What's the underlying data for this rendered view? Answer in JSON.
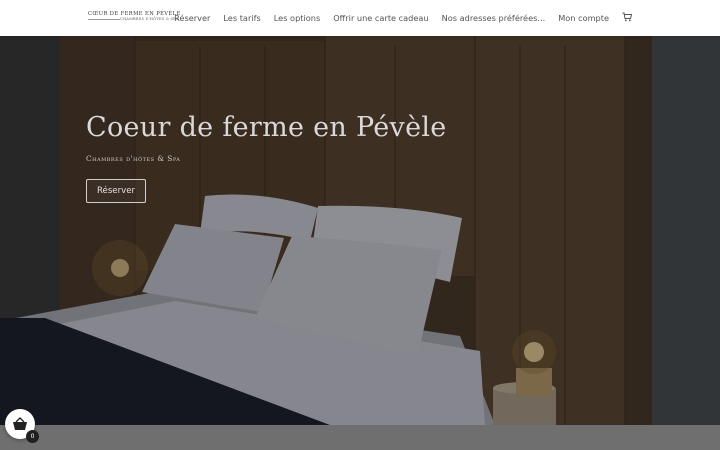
{
  "logo": {
    "title": "Cœur de ferme en Pévèle",
    "subtitle": "Chambres d'hôtes & Spa"
  },
  "nav": {
    "items": [
      "Réserver",
      "Les tarifs",
      "Les options",
      "Offrir une carte cadeau",
      "Nos adresses préférées...",
      "Mon compte"
    ],
    "cart_icon": "cart-icon"
  },
  "hero": {
    "title": "Coeur de ferme en Pévèle",
    "subtitle": "Chambres d'hôtes & Spa",
    "button_label": "Réserver"
  },
  "cart_widget": {
    "icon": "basket-icon",
    "count": "0"
  },
  "colors": {
    "header_bg": "#ffffff",
    "nav_text": "#555555",
    "hero_overlay": "#3a3a3c",
    "bottom_band": "#6f6f6f"
  }
}
